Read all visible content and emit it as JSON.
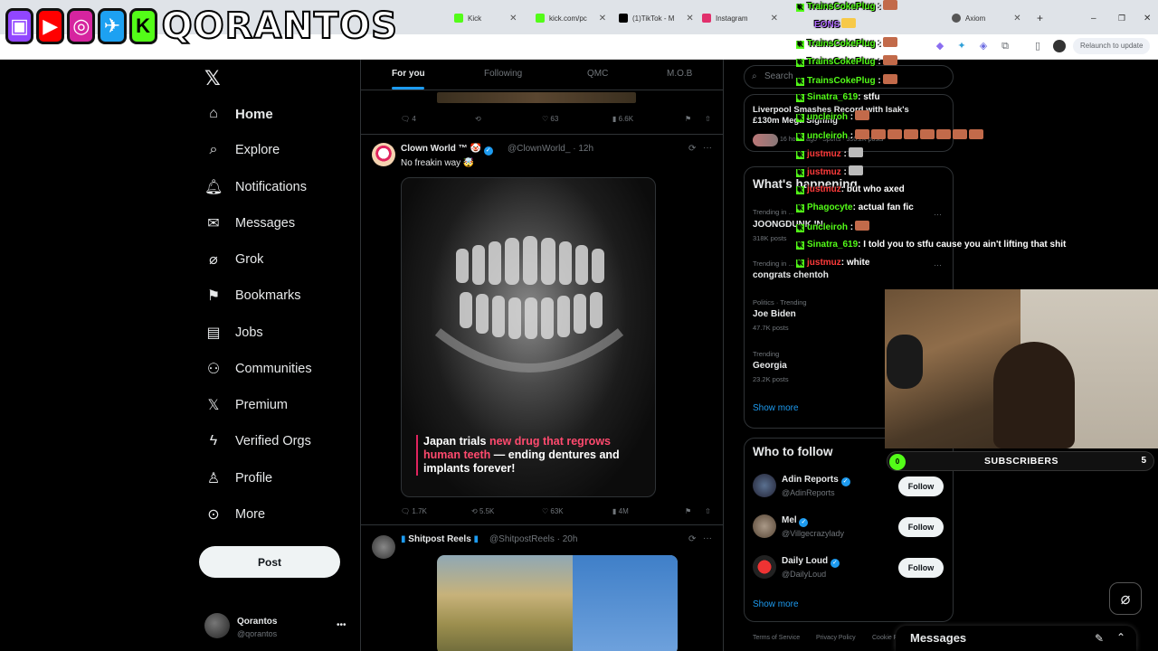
{
  "browser": {
    "tabs": [
      {
        "label": "Kick",
        "color": "#53fc18"
      },
      {
        "label": "kick.com/pc",
        "color": "#53fc18"
      },
      {
        "label": "(1)TikTok - M",
        "color": "#000000"
      },
      {
        "label": "Instagram",
        "color": "#e1306c"
      },
      {
        "label": "Axiom",
        "color": "#555555"
      }
    ],
    "relaunch_label": "Relaunch to update"
  },
  "overlay": {
    "logo_text": "QORANTOS",
    "social_icons": [
      "twitch-icon",
      "youtube-icon",
      "instagram-icon",
      "twitter-icon",
      "kick-icon"
    ]
  },
  "nav": {
    "items": [
      {
        "label": "Home",
        "icon": "home-icon",
        "active": true
      },
      {
        "label": "Explore",
        "icon": "search-icon"
      },
      {
        "label": "Notifications",
        "icon": "bell-icon"
      },
      {
        "label": "Messages",
        "icon": "mail-icon"
      },
      {
        "label": "Grok",
        "icon": "grok-icon"
      },
      {
        "label": "Bookmarks",
        "icon": "bookmark-icon"
      },
      {
        "label": "Jobs",
        "icon": "briefcase-icon"
      },
      {
        "label": "Communities",
        "icon": "people-icon"
      },
      {
        "label": "Premium",
        "icon": "x-logo-icon"
      },
      {
        "label": "Verified Orgs",
        "icon": "lightning-icon"
      },
      {
        "label": "Profile",
        "icon": "person-icon"
      },
      {
        "label": "More",
        "icon": "more-circle-icon"
      }
    ],
    "post_label": "Post",
    "account": {
      "name": "Qorantos",
      "handle": "@qorantos"
    }
  },
  "feed": {
    "tabs": [
      "For you",
      "Following",
      "QMC",
      "M.O.B"
    ],
    "prev_actions": {
      "replies": "4",
      "reposts": "",
      "likes": "63",
      "views": "6.6K"
    },
    "tweet1": {
      "name": "Clown World ™",
      "handle": "@ClownWorld_",
      "time": "· 12h",
      "text": "No freakin way 🤯",
      "caption_white1": "Japan trials ",
      "caption_red1": "new drug that regrows",
      "caption_red2": "human teeth",
      "caption_white2": " — ending dentures and implants forever!",
      "replies": "1.7K",
      "reposts": "5.5K",
      "likes": "63K",
      "views": "4M"
    },
    "tweet2": {
      "name": "Shitpost Reels",
      "handle": "@ShitpostReels",
      "time": "· 20h"
    }
  },
  "sidebar": {
    "search_placeholder": "Search",
    "news_headline": "Liverpool Smashes Record with Isak's £130m Mega Signing",
    "news_meta": "16 hours ago · Sports · 350.2K posts",
    "whats_happening": "What's happening",
    "trends": [
      {
        "meta": "Trending in ...",
        "name": "JOONGDUNK IN ...",
        "posts": "318K posts"
      },
      {
        "meta": "Trending in ...",
        "name": "congrats chentoh",
        "posts": ""
      },
      {
        "meta": "Politics · Trending",
        "name": "Joe Biden",
        "posts": "47.7K posts"
      },
      {
        "meta": "Trending",
        "name": "Georgia",
        "posts": "23.2K posts"
      }
    ],
    "show_more": "Show more",
    "who_to_follow": "Who to follow",
    "follow_suggestions": [
      {
        "name": "Adin Reports",
        "handle": "@AdinReports",
        "button": "Follow"
      },
      {
        "name": "Mel",
        "handle": "@Villgecrazylady",
        "button": "Follow"
      },
      {
        "name": "Daily Loud",
        "handle": "@DailyLoud",
        "button": "Follow"
      }
    ],
    "show_more_2": "Show more",
    "footer": [
      "Terms of Service",
      "Privacy Policy",
      "Cookie P..."
    ]
  },
  "messages_drawer": {
    "title": "Messages"
  },
  "chat": [
    {
      "user": "TrainsCokePlug",
      "msg": ""
    },
    {
      "user": "EONS",
      "msg": ""
    },
    {
      "user": "TrainsCokePlug",
      "msg": ""
    },
    {
      "user": "TrainsCokePlug",
      "msg": ""
    },
    {
      "user": "TrainsCokePlug",
      "msg": ""
    },
    {
      "user": "Sinatra_619",
      "msg": ": stfu"
    },
    {
      "user": "uncleiroh",
      "msg": ""
    },
    {
      "user": "uncleiroh",
      "msg": ""
    },
    {
      "user": "justmuz",
      "msg": ""
    },
    {
      "user": "justmuz",
      "msg": ""
    },
    {
      "user": "justmuz",
      "msg": ": but who axed"
    },
    {
      "user": "Phagocyte",
      "msg": ": actual fan fic"
    },
    {
      "user": "uncleiroh",
      "msg": ""
    },
    {
      "user": "Sinatra_619",
      "msg": ": I told you to stfu cause you ain't lifting that shit"
    },
    {
      "user": "justmuz",
      "msg": ": white"
    }
  ],
  "sub_goal": {
    "current": "0",
    "label": "SUBSCRIBERS",
    "goal": "5"
  },
  "colors": {
    "accent": "#1d9bf0",
    "kick_green": "#53fc18"
  }
}
